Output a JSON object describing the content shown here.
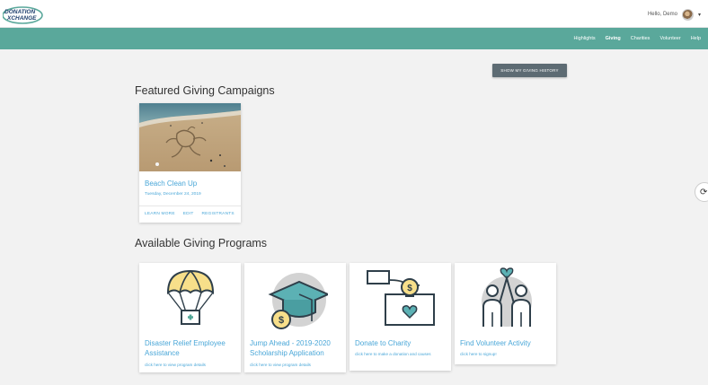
{
  "header": {
    "logo_text": "DonationXchange",
    "greeting": "Hello, Demo",
    "caret": "▾"
  },
  "nav": {
    "items": [
      {
        "label": "Highlights",
        "active": false
      },
      {
        "label": "Giving",
        "active": true
      },
      {
        "label": "Charities",
        "active": false
      },
      {
        "label": "Volunteer",
        "active": false
      },
      {
        "label": "Help",
        "active": false
      }
    ]
  },
  "colors": {
    "nav_bg": "#5aa89b",
    "link": "#4aa7d8",
    "button_bg": "#5d6b73"
  },
  "history_button": "SHOW MY GIVING HISTORY",
  "featured": {
    "title": "Featured Giving Campaigns",
    "campaigns": [
      {
        "title": "Beach Clean Up",
        "date": "Tuesday, December 24, 2019",
        "actions": [
          "LEARN MORE",
          "EDIT",
          "REGISTRANTS"
        ]
      }
    ]
  },
  "programs": {
    "title": "Available Giving Programs",
    "items": [
      {
        "title": "Disaster Relief Employee Assistance",
        "link": "click here to view program details",
        "icon": "parachute-aid-icon"
      },
      {
        "title": "Jump Ahead - 2019-2020 Scholarship Application",
        "link": "click here to view program details",
        "icon": "graduation-cap-icon"
      },
      {
        "title": "Donate to Charity",
        "link": "click here to make a donation and causes",
        "icon": "donate-box-icon"
      },
      {
        "title": "Find Volunteer Activity",
        "link": "click here to signup!",
        "icon": "volunteers-icon"
      }
    ]
  }
}
